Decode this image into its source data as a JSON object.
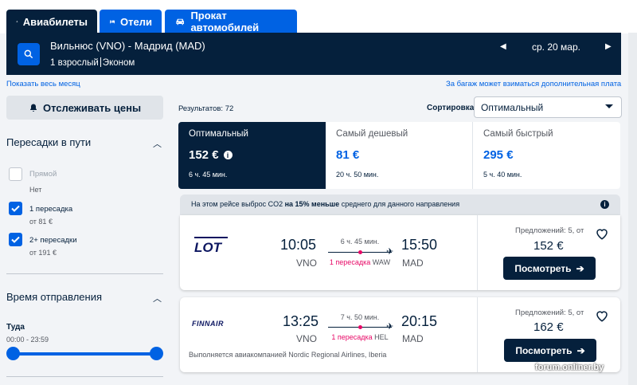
{
  "tabs": [
    {
      "label": "Авиабилеты",
      "icon": "plane-icon"
    },
    {
      "label": "Отели",
      "icon": "bed-icon"
    },
    {
      "label": "Прокат автомобилей",
      "icon": "car-icon"
    }
  ],
  "search": {
    "route": "Вильнюс (VNO) - Мадрид (MAD)",
    "passengers": "1 взрослый",
    "cabin": "Эконом",
    "date": "ср. 20 мар."
  },
  "links": {
    "whole_month": "Показать весь месяц",
    "baggage_fee": "За багаж может взиматься дополнительная плата"
  },
  "sidebar": {
    "track_prices": "Отслеживать цены",
    "stops_title": "Пересадки в пути",
    "stops": [
      {
        "label": "Прямой",
        "sub": "Нет",
        "checked": false
      },
      {
        "label": "1 пересадка",
        "sub": "от 81 €",
        "checked": true
      },
      {
        "label": "2+ пересадки",
        "sub": "от 191 €",
        "checked": true
      }
    ],
    "departure_title": "Время отправления",
    "departure_label": "Туда",
    "departure_range": "00:00 - 23:59"
  },
  "results": {
    "count": "Результатов: 72",
    "sort_label": "Сортировка",
    "sort_value": "Оптимальный"
  },
  "sort_tabs": [
    {
      "title": "Оптимальный",
      "price": "152 €",
      "duration": "6 ч. 45 мин."
    },
    {
      "title": "Самый дешевый",
      "price": "81 €",
      "duration": "20 ч. 50 мин."
    },
    {
      "title": "Самый быстрый",
      "price": "295 €",
      "duration": "5 ч. 40 мин."
    }
  ],
  "co2": {
    "prefix": "На этом рейсе выброс CO2 ",
    "bold": "на 15% меньше",
    "suffix": " среднего для данного направления"
  },
  "flights": [
    {
      "airline": "LOT",
      "dep_time": "10:05",
      "dep_code": "VNO",
      "arr_time": "15:50",
      "arr_code": "MAD",
      "duration": "6 ч. 45 мин.",
      "stops": "1 пересадка",
      "via": "WAW",
      "offers": "Предложений: 5, от",
      "price": "152 €",
      "button": "Посмотреть",
      "operated": ""
    },
    {
      "airline": "FINNAIR",
      "dep_time": "13:25",
      "dep_code": "VNO",
      "arr_time": "20:15",
      "arr_code": "MAD",
      "duration": "7 ч. 50 мин.",
      "stops": "1 пересадка",
      "via": "HEL",
      "offers": "Предложений: 5, от",
      "price": "162 €",
      "button": "Посмотреть",
      "operated": "Выполняется авиакомпанией Nordic Regional Airlines, Iberia"
    }
  ],
  "watermark": "forum.onliner.by",
  "colors": {
    "navy": "#05203c",
    "blue": "#0062e3",
    "pink": "#e70866"
  }
}
